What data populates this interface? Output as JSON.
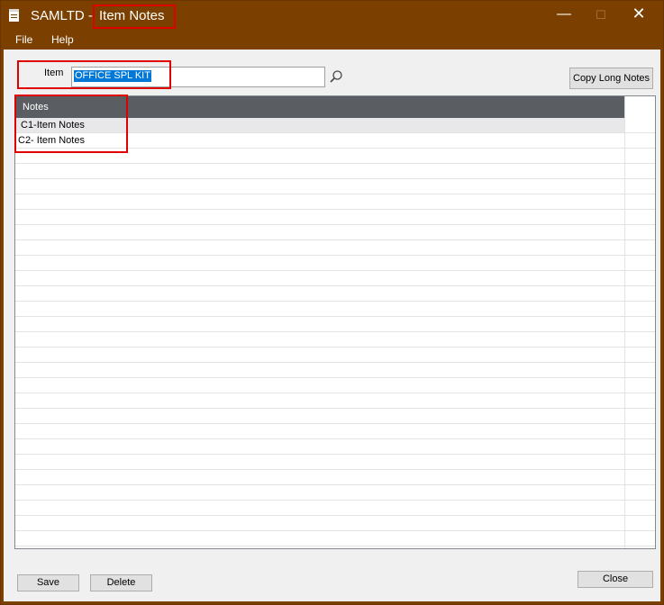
{
  "titlebar": {
    "app_name": "SAMLTD -",
    "window_name": "Item Notes",
    "minimize_glyph": "—",
    "maximize_glyph": "☐",
    "close_glyph": "✕"
  },
  "menu": {
    "items": [
      {
        "label": "File"
      },
      {
        "label": "Help"
      }
    ]
  },
  "item_field": {
    "label": "Item",
    "value": "OFFICE SPL KIT"
  },
  "buttons": {
    "copy_long_notes": "Copy Long Notes",
    "save": "Save",
    "delete": "Delete",
    "close": "Close"
  },
  "grid": {
    "header": "Notes",
    "rows": [
      {
        "text": "C1-Item Notes"
      },
      {
        "text": "C2- Item Notes"
      }
    ]
  },
  "icons": {
    "app": "notepad-icon",
    "lookup": "magnifier-icon"
  },
  "colors": {
    "titlebar": "#7b3f00",
    "highlight_box": "#e00000",
    "grid_header": "#5a5d62",
    "selection": "#0078d7"
  }
}
